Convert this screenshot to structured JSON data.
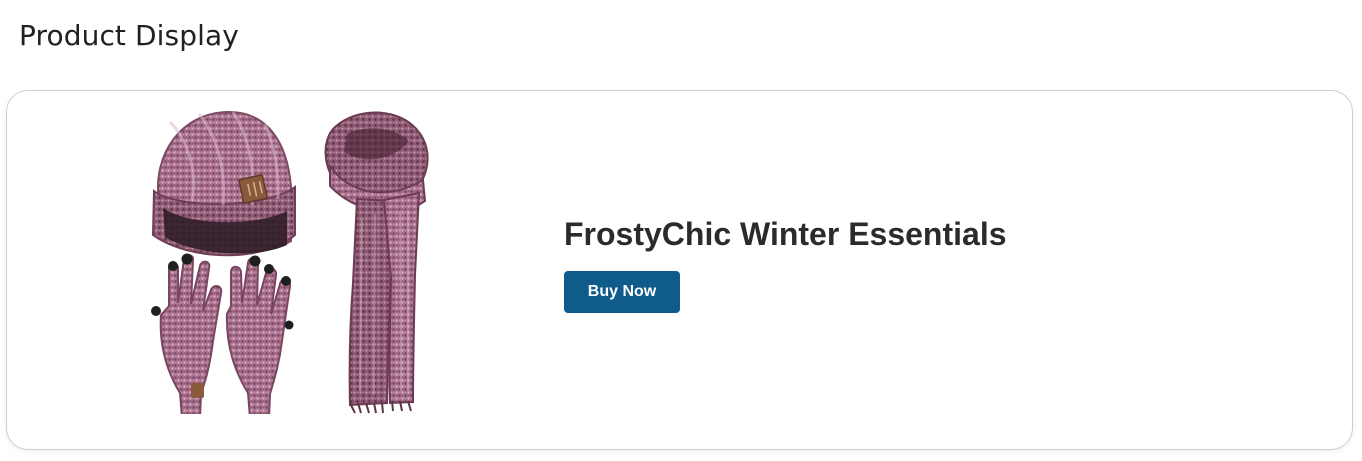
{
  "page": {
    "title": "Product Display"
  },
  "product": {
    "title": "FrostyChic Winter Essentials",
    "image_subject": "winter-hat-scarf-gloves-set",
    "buy_label": "Buy Now"
  },
  "colors": {
    "button_bg": "#0f5b8a",
    "button_text": "#ffffff",
    "knit_primary": "#8a5a73",
    "knit_light": "#c49ab0",
    "knit_dark": "#5f3448",
    "patch": "#8b5a3c"
  }
}
